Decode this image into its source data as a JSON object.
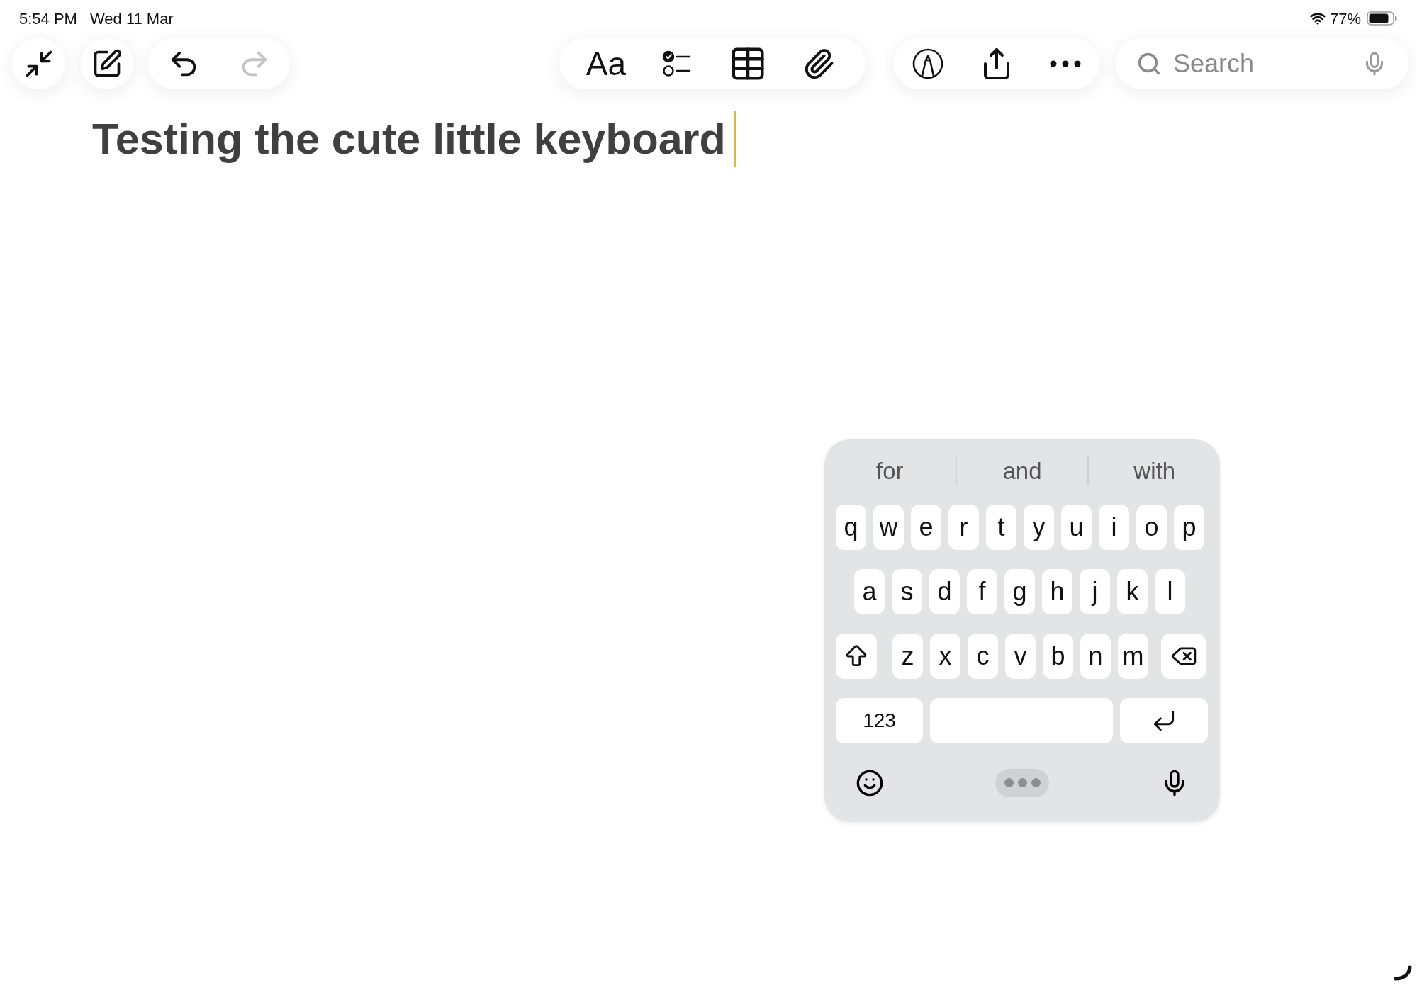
{
  "status_bar": {
    "time": "5:54 PM",
    "date": "Wed 11 Mar",
    "battery": "77%"
  },
  "toolbar": {
    "groups": [
      {
        "items": [
          {
            "kind": "collapse"
          }
        ]
      },
      {
        "items": [
          {
            "kind": "compose"
          }
        ]
      },
      {
        "items": [
          {
            "kind": "undo",
            "disabled": false
          },
          {
            "kind": "redo",
            "disabled": true
          }
        ]
      },
      {
        "items": [
          {
            "kind": "format",
            "label": "Aa"
          },
          {
            "kind": "checklist"
          },
          {
            "kind": "table"
          },
          {
            "kind": "attach"
          }
        ]
      },
      {
        "items": [
          {
            "kind": "markup"
          },
          {
            "kind": "share"
          },
          {
            "kind": "more"
          }
        ]
      }
    ],
    "search": {
      "placeholder": "Search"
    }
  },
  "note": {
    "title": "Testing the cute little keyboard"
  },
  "keyboard": {
    "suggestions": [
      "for",
      "and",
      "with"
    ],
    "rows": [
      {
        "keys": [
          {
            "kind": "letter",
            "label": "q"
          },
          {
            "kind": "letter",
            "label": "w"
          },
          {
            "kind": "letter",
            "label": "e"
          },
          {
            "kind": "letter",
            "label": "r"
          },
          {
            "kind": "letter",
            "label": "t"
          },
          {
            "kind": "letter",
            "label": "y"
          },
          {
            "kind": "letter",
            "label": "u"
          },
          {
            "kind": "letter",
            "label": "i"
          },
          {
            "kind": "letter",
            "label": "o"
          },
          {
            "kind": "letter",
            "label": "p"
          }
        ]
      },
      {
        "keys": [
          {
            "kind": "letter",
            "label": "a"
          },
          {
            "kind": "letter",
            "label": "s"
          },
          {
            "kind": "letter",
            "label": "d"
          },
          {
            "kind": "letter",
            "label": "f"
          },
          {
            "kind": "letter",
            "label": "g"
          },
          {
            "kind": "letter",
            "label": "h"
          },
          {
            "kind": "letter",
            "label": "j"
          },
          {
            "kind": "letter",
            "label": "k"
          },
          {
            "kind": "letter",
            "label": "l"
          }
        ]
      },
      {
        "keys": [
          {
            "kind": "shift"
          },
          {
            "kind": "letter",
            "label": "z"
          },
          {
            "kind": "letter",
            "label": "x"
          },
          {
            "kind": "letter",
            "label": "c"
          },
          {
            "kind": "letter",
            "label": "v"
          },
          {
            "kind": "letter",
            "label": "b"
          },
          {
            "kind": "letter",
            "label": "n"
          },
          {
            "kind": "letter",
            "label": "m"
          },
          {
            "kind": "delete"
          }
        ]
      },
      {
        "keys": [
          {
            "kind": "numbers",
            "label": "123"
          },
          {
            "kind": "space"
          },
          {
            "kind": "return"
          }
        ]
      }
    ]
  }
}
